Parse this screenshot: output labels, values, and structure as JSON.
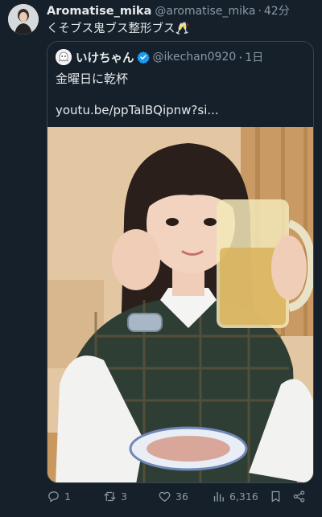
{
  "author": {
    "display_name": "Aromatise_mika",
    "handle": "@aromatise_mika",
    "separator": "·",
    "time": "42分",
    "text": "くそブス鬼ブス整形ブス🥂"
  },
  "quoted": {
    "display_name": "いけちゃん",
    "handle": "@ikechan0920",
    "separator": "·",
    "time": "1日",
    "text": "金曜日に乾杯",
    "link": "youtu.be/ppTaIBQipnw?si..."
  },
  "stats": {
    "replies": "1",
    "reposts": "3",
    "likes": "36",
    "views": "6,316"
  },
  "icons": {
    "reply": "reply-icon",
    "repost": "repost-icon",
    "like": "like-icon",
    "views": "views-icon",
    "bookmark": "bookmark-icon",
    "share": "share-icon",
    "verified": "verified-badge-icon"
  },
  "colors": {
    "background": "#15202b",
    "text": "#e7e9ea",
    "muted": "#8b98a5",
    "border": "#38444d",
    "verified": "#1d9bf0"
  }
}
